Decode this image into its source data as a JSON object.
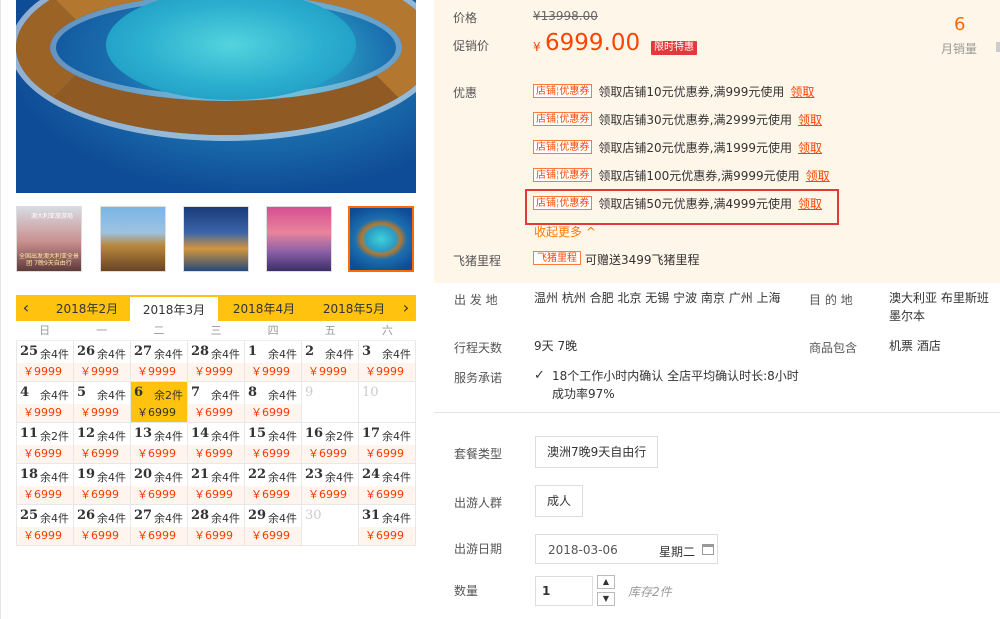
{
  "calendar": {
    "months": [
      "2018年2月",
      "2018年3月",
      "2018年4月",
      "2018年5月"
    ],
    "selected_month": "2018年3月",
    "weekdays": [
      "日",
      "一",
      "二",
      "三",
      "四",
      "五",
      "六"
    ],
    "cells": [
      {
        "day": "25",
        "stock": "余4件",
        "price": "￥9999"
      },
      {
        "day": "26",
        "stock": "余4件",
        "price": "￥9999"
      },
      {
        "day": "27",
        "stock": "余4件",
        "price": "￥9999"
      },
      {
        "day": "28",
        "stock": "余4件",
        "price": "￥9999"
      },
      {
        "day": "1",
        "stock": "余4件",
        "price": "￥9999"
      },
      {
        "day": "2",
        "stock": "余4件",
        "price": "￥9999"
      },
      {
        "day": "3",
        "stock": "余4件",
        "price": "￥9999"
      },
      {
        "day": "4",
        "stock": "余4件",
        "price": "￥9999"
      },
      {
        "day": "5",
        "stock": "余4件",
        "price": "￥9999"
      },
      {
        "day": "6",
        "stock": "余2件",
        "price": "￥6999",
        "selected": true
      },
      {
        "day": "7",
        "stock": "余4件",
        "price": "￥6999"
      },
      {
        "day": "8",
        "stock": "余4件",
        "price": "￥6999"
      },
      {
        "day": "9",
        "disabled": true
      },
      {
        "day": "10",
        "disabled": true
      },
      {
        "day": "11",
        "stock": "余2件",
        "price": "￥6999"
      },
      {
        "day": "12",
        "stock": "余4件",
        "price": "￥6999"
      },
      {
        "day": "13",
        "stock": "余4件",
        "price": "￥6999"
      },
      {
        "day": "14",
        "stock": "余4件",
        "price": "￥6999"
      },
      {
        "day": "15",
        "stock": "余4件",
        "price": "￥6999"
      },
      {
        "day": "16",
        "stock": "余2件",
        "price": "￥6999"
      },
      {
        "day": "17",
        "stock": "余4件",
        "price": "￥6999"
      },
      {
        "day": "18",
        "stock": "余4件",
        "price": "￥6999"
      },
      {
        "day": "19",
        "stock": "余4件",
        "price": "￥6999"
      },
      {
        "day": "20",
        "stock": "余4件",
        "price": "￥6999"
      },
      {
        "day": "21",
        "stock": "余4件",
        "price": "￥6999"
      },
      {
        "day": "22",
        "stock": "余4件",
        "price": "￥6999"
      },
      {
        "day": "23",
        "stock": "余4件",
        "price": "￥6999"
      },
      {
        "day": "24",
        "stock": "余4件",
        "price": "￥6999"
      },
      {
        "day": "25",
        "stock": "余4件",
        "price": "￥6999"
      },
      {
        "day": "26",
        "stock": "余4件",
        "price": "￥6999"
      },
      {
        "day": "27",
        "stock": "余4件",
        "price": "￥6999"
      },
      {
        "day": "28",
        "stock": "余4件",
        "price": "￥6999"
      },
      {
        "day": "29",
        "stock": "余4件",
        "price": "￥6999"
      },
      {
        "day": "30",
        "disabled": true
      },
      {
        "day": "31",
        "stock": "余4件",
        "price": "￥6999"
      }
    ]
  },
  "thumb1": {
    "logo": "澳大利亚旅游局",
    "caption": "全国出发澳大利亚全景团 7晚9天自由行"
  },
  "price": {
    "label": "价格",
    "original": "¥13998.00",
    "sale_label": "促销价",
    "currency": "¥",
    "sale": "6999.00",
    "limited_tag": "限时特惠",
    "monthly_sales": "6",
    "monthly_sales_label": "月销量"
  },
  "coupons": {
    "label": "优惠",
    "tag_left": "店铺",
    "tag_right": "优惠券",
    "get": "领取",
    "items": [
      "领取店铺10元优惠券,满999元使用",
      "领取店铺30元优惠券,满2999元使用",
      "领取店铺20元优惠券,满1999元使用",
      "领取店铺100元优惠券,满9999元使用",
      "领取店铺50元优惠券,满4999元使用"
    ],
    "collapse": "收起更多 ^"
  },
  "mileage": {
    "label": "飞猪里程",
    "tag": "飞猪里程",
    "text": "可赠送3499飞猪里程"
  },
  "info": {
    "departure_label": "出 发 地",
    "departure": "温州  杭州  合肥  北京  无锡  宁波  南京  广州  上海",
    "destination_label": "目 的 地",
    "destination": "澳大利亚  布里斯班  墨尔本",
    "days_label": "行程天数",
    "days": "9天  7晚",
    "includes_label": "商品包含",
    "includes": "机票  酒店",
    "promise_label": "服务承诺",
    "promise": "18个工作小时内确认 全店平均确认时长:8小时 成功率97%"
  },
  "options": {
    "package_label": "套餐类型",
    "package": "澳洲7晚9天自由行",
    "people_label": "出游人群",
    "people": "成人",
    "date_label": "出游日期",
    "date": "2018-03-06",
    "weekday": "星期二",
    "qty_label": "数量",
    "qty": "1",
    "stock": "库存2件"
  }
}
